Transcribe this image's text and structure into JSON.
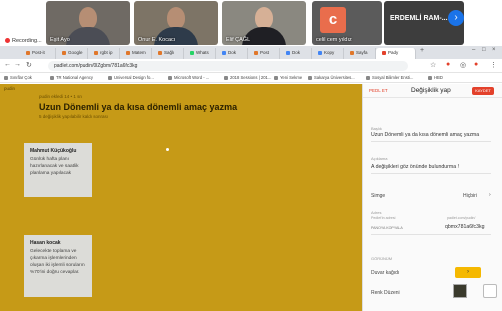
{
  "meeting": {
    "participants": [
      {
        "name": "Eşit Ayo"
      },
      {
        "name": "Onur E. Kocacı"
      },
      {
        "name": "Elif ÇAĞL"
      },
      {
        "name": "celil cem yıldız",
        "initial": "c"
      },
      {
        "name": "ERDEMLİ RAM-..."
      }
    ],
    "recording_label": "Recording...",
    "next_icon": "chevron-right-icon"
  },
  "browser": {
    "tabs": [
      {
        "label": "Post-it"
      },
      {
        "label": "Google"
      },
      {
        "label": "rgbt ip"
      },
      {
        "label": "Matem"
      },
      {
        "label": "Sağlı"
      },
      {
        "label": "Whats"
      },
      {
        "label": "Dok"
      },
      {
        "label": "Post"
      },
      {
        "label": "Dok"
      },
      {
        "label": "Kopy"
      },
      {
        "label": "Sayfa"
      },
      {
        "label": "Pady"
      }
    ],
    "url": "padlet.com/pudin/0lZgbm/781a6fc3kg",
    "bookmarks": [
      "Sınıflar Çok",
      "TR National Agency",
      "Universal Design fo...",
      "Microsoft Word - ...",
      "2018 Sessions | 201...",
      "Yeni Sekme",
      "Sakarya Üniversites...",
      "Sosyal Bilimler Ensti...",
      "HBD"
    ]
  },
  "padlet": {
    "author": "pudin",
    "meta": "pudin ekledi 14 • 1 sn",
    "title": "Uzun Dönemli ya da kısa dönemli amaç yazma",
    "subtitle": "5 değişiklik yapılabilir kaldı sonrası",
    "posts": [
      {
        "author": "Mahmut Küçükoğlu",
        "text": "Günlük hafta planı hazırlanacak ve saatlik planlama yapılacak"
      },
      {
        "author": "Hasan kocak",
        "text": "Gelecekte toplama ve çıkarma işlemlerinden oluşan iki işlemli soruların %70'ini doğru cevaplar."
      }
    ]
  },
  "panel": {
    "back_label": "PEDL ET",
    "title": "Değişiklik yap",
    "save_label": "KAYDET",
    "fields": {
      "title_label": "Başlık",
      "title_value": "Uzun Dönemli ya da kısa dönemli amaç yazma",
      "desc_label": "Açıklama",
      "desc_value": "A değişikleri göz önünde bulundurma !",
      "icon_label": "Simge",
      "icon_value": "Hiçbiri",
      "address_label": "Adres",
      "address_hint": "Pedlet'in adresi",
      "address_value": "qbmx781a6fc3kg",
      "address_prefix": "padlet.com/pudin/",
      "pane_label": "PANOYA KOPYALA",
      "section_label": "GÖRÜNÜM",
      "wallpaper_label": "Duvar kağıdı",
      "theme_label": "Renk Düzeni"
    }
  }
}
